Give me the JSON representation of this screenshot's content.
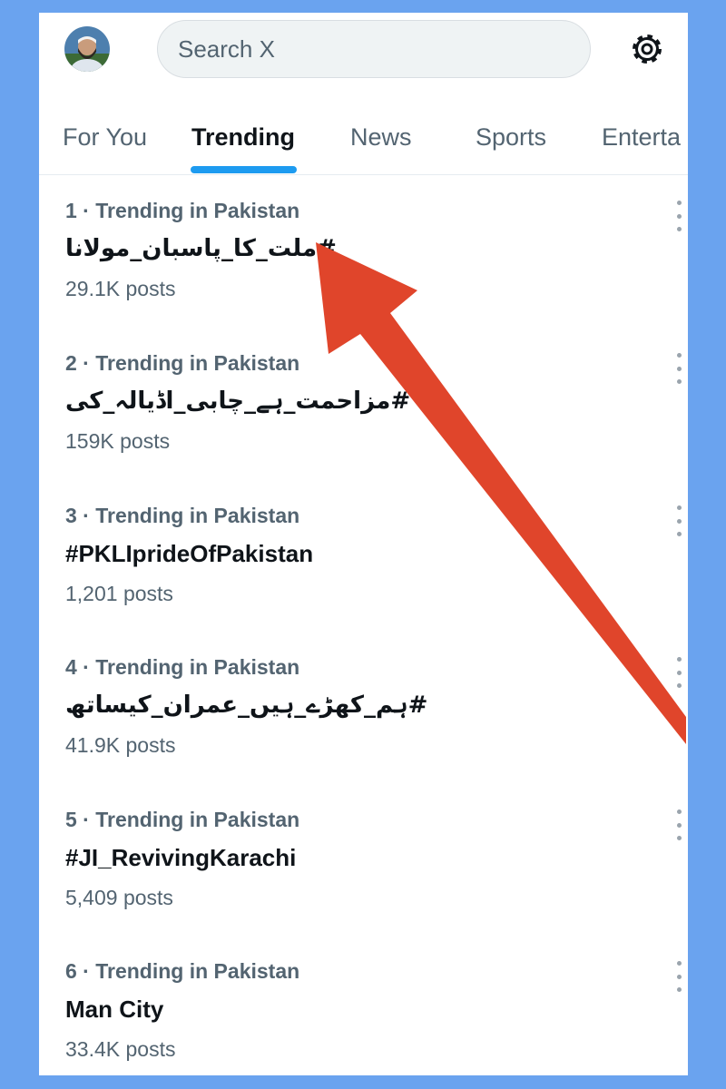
{
  "search": {
    "placeholder": "Search X"
  },
  "tabs": [
    {
      "label": "For You"
    },
    {
      "label": "Trending"
    },
    {
      "label": "News"
    },
    {
      "label": "Sports"
    },
    {
      "label": "Enterta"
    }
  ],
  "active_tab": "Trending",
  "trends": [
    {
      "meta": "1 · Trending in Pakistan",
      "title": "#ملت_کا_پاسبان_مولانا",
      "posts": "29.1K posts"
    },
    {
      "meta": "2 · Trending in Pakistan",
      "title": "#مزاحمت_ہے_چابی_اڈیالہ_کی",
      "posts": "159K posts"
    },
    {
      "meta": "3 · Trending in Pakistan",
      "title": "#PKLIprideOfPakistan",
      "posts": "1,201 posts"
    },
    {
      "meta": "4 · Trending in Pakistan",
      "title": "#ہم_کھڑے_ہیں_عمران_کیساتھ",
      "posts": "41.9K posts"
    },
    {
      "meta": "5 · Trending in Pakistan",
      "title": "#JI_RevivingKarachi",
      "posts": "5,409 posts"
    },
    {
      "meta": "6 · Trending in Pakistan",
      "title": "Man City",
      "posts": "33.4K posts"
    }
  ],
  "icons": {
    "settings": "gear-icon",
    "more": "more-vertical-icon",
    "avatar": "user-avatar"
  },
  "colors": {
    "background_frame": "#6aa3ef",
    "accent": "#1d9bf0",
    "annotation_arrow": "#e0452b",
    "text_primary": "#0f1419",
    "text_secondary": "#536471"
  }
}
